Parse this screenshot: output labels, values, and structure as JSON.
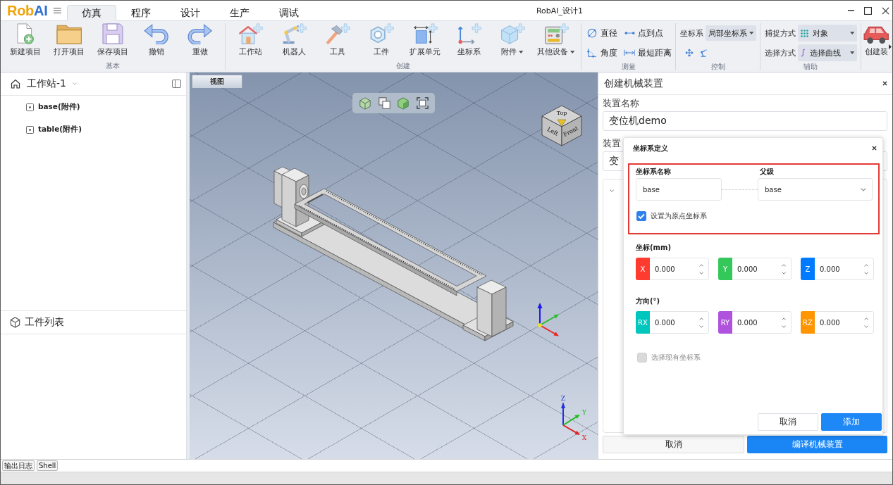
{
  "window": {
    "logo": [
      {
        "text": "Rob",
        "color": "#f0a30a"
      },
      {
        "text": "AI",
        "color": "#2e6fd6"
      }
    ],
    "title": "RobAI_设计1"
  },
  "menu_tabs": [
    {
      "label": "仿真",
      "selected": true
    },
    {
      "label": "程序",
      "selected": false
    },
    {
      "label": "设计",
      "selected": false
    },
    {
      "label": "生产",
      "selected": false
    },
    {
      "label": "调试",
      "selected": false
    }
  ],
  "ribbon": [
    {
      "label": "基本",
      "kind": "large",
      "buttons": [
        {
          "label": "新建项目",
          "dropdown": false
        },
        {
          "label": "打开项目",
          "dropdown": false
        },
        {
          "label": "保存项目",
          "dropdown": false
        },
        {
          "label": "撤销",
          "dropdown": false
        },
        {
          "label": "重做",
          "dropdown": false
        }
      ]
    },
    {
      "label": "创建",
      "kind": "large",
      "buttons": [
        {
          "label": "工作站",
          "dropdown": false
        },
        {
          "label": "机器人",
          "dropdown": false
        },
        {
          "label": "工具",
          "dropdown": false
        },
        {
          "label": "工件",
          "dropdown": false
        },
        {
          "label": "扩展单元",
          "dropdown": false
        },
        {
          "label": "坐标系",
          "dropdown": false
        },
        {
          "label": "附件",
          "dropdown": true
        },
        {
          "label": "其他设备",
          "dropdown": true
        }
      ]
    },
    {
      "label": "测量",
      "kind": "tools",
      "buttons": [
        {
          "label": "直径"
        },
        {
          "label": "点到点"
        },
        {
          "label": "角度"
        },
        {
          "label": "最短距离"
        }
      ]
    },
    {
      "label": "控制",
      "kind": "control",
      "field_label": "坐标系",
      "value": "局部坐标系"
    },
    {
      "label": "辅助",
      "kind": "selects",
      "rows": [
        {
          "label": "捕捉方式",
          "value": "对象"
        },
        {
          "label": "选择方式",
          "value": "选择曲线"
        }
      ]
    },
    {
      "kind": "large",
      "buttons": [
        {
          "label": "创建装",
          "dropdown": false
        }
      ]
    }
  ],
  "station_tree": {
    "label": "工作站-1",
    "children": [
      {
        "label": "base(附件)"
      },
      {
        "label": "table(附件)"
      }
    ]
  },
  "parts_list": {
    "title": "工件列表"
  },
  "viewport": {
    "tab": "视图",
    "cube_faces": [
      "Top",
      "Left",
      "Front"
    ],
    "triad": [
      {
        "label": "Z",
        "color": "#2233dd"
      },
      {
        "label": "Y",
        "color": "#22bb22"
      },
      {
        "label": "X",
        "color": "#dd2222"
      }
    ]
  },
  "device_panel": {
    "title": "创建机械装置",
    "fields": [
      {
        "label": "装置名称",
        "value": "变位机demo"
      },
      {
        "label": "装置",
        "value": "变"
      }
    ],
    "buttons": [
      {
        "label": "取消",
        "kind": "secondary"
      },
      {
        "label": "编译机械装置",
        "kind": "primary"
      }
    ]
  },
  "frame_dialog": {
    "title": "坐标系定义",
    "highlighted": true,
    "name_label": "坐标系名称",
    "name": "base",
    "parent_label": "父级",
    "parent": "base",
    "origin": {
      "label": "设置为原点坐标系",
      "checked": true,
      "disabled": false
    },
    "sections": [
      {
        "label": "坐标(mm)",
        "fields": [
          {
            "tag": "X",
            "value": "0.000",
            "color": "#ff3b30"
          },
          {
            "tag": "Y",
            "value": "0.000",
            "color": "#34c759"
          },
          {
            "tag": "Z",
            "value": "0.000",
            "color": "#007aff"
          }
        ]
      },
      {
        "label": "方向(°)",
        "fields": [
          {
            "tag": "RX",
            "value": "0.000",
            "color": "#00c7be"
          },
          {
            "tag": "RY",
            "value": "0.000",
            "color": "#af52de"
          },
          {
            "tag": "RZ",
            "value": "0.000",
            "color": "#ff9500"
          }
        ]
      }
    ],
    "existing": {
      "label": "选择现有坐标系",
      "checked": false,
      "disabled": true
    },
    "buttons": [
      {
        "label": "取消",
        "kind": "secondary"
      },
      {
        "label": "添加",
        "kind": "primary"
      }
    ]
  },
  "output_tabs": [
    {
      "label": "输出日志"
    },
    {
      "label": "Shell"
    }
  ]
}
